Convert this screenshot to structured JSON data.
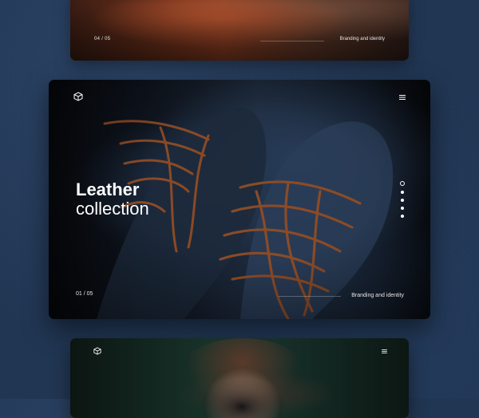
{
  "top_card": {
    "counter": "04 / 05",
    "tag": "Branding and identity"
  },
  "main_card": {
    "title_bold": "Leather",
    "title_light": "collection",
    "counter": "01 / 05",
    "tag": "Branding and identity",
    "icons": {
      "logo": "cube-logo-icon",
      "menu": "hamburger-menu-icon"
    },
    "pagination": {
      "total": 5,
      "active": 1
    }
  },
  "bottom_card": {
    "icons": {
      "logo": "cube-logo-icon",
      "menu": "hamburger-menu-icon"
    }
  },
  "colors": {
    "background": "#213653",
    "text": "#ffffff",
    "accent_leather": "#8e3e22"
  }
}
